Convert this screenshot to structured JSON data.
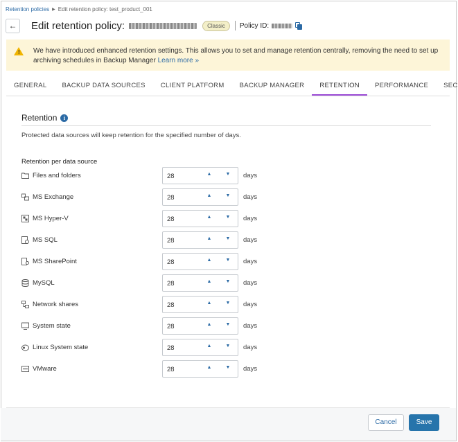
{
  "breadcrumb": {
    "parent": "Retention policies",
    "current": "Edit retention policy: test_product_001"
  },
  "header": {
    "title": "Edit retention policy:",
    "badge": "Classic",
    "policy_id_label": "Policy ID:"
  },
  "banner": {
    "text": "We have introduced enhanced retention settings. This allows you to set and manage retention centrally, removing the need to set up archiving schedules in Backup Manager",
    "link": "Learn more »"
  },
  "tabs": [
    {
      "label": "GENERAL"
    },
    {
      "label": "BACKUP DATA SOURCES"
    },
    {
      "label": "CLIENT PLATFORM"
    },
    {
      "label": "BACKUP MANAGER"
    },
    {
      "label": "RETENTION"
    },
    {
      "label": "PERFORMANCE"
    },
    {
      "label": "SECURITY"
    }
  ],
  "active_tab": "RETENTION",
  "section": {
    "title": "Retention",
    "description": "Protected data sources will keep retention for the specified number of days.",
    "subheading": "Retention per data source"
  },
  "rows": [
    {
      "label": "Files and folders",
      "value": "28",
      "unit": "days",
      "icon": "folder-icon"
    },
    {
      "label": "MS Exchange",
      "value": "28",
      "unit": "days",
      "icon": "exchange-icon"
    },
    {
      "label": "MS Hyper-V",
      "value": "28",
      "unit": "days",
      "icon": "hyperv-icon"
    },
    {
      "label": "MS SQL",
      "value": "28",
      "unit": "days",
      "icon": "sql-icon"
    },
    {
      "label": "MS SharePoint",
      "value": "28",
      "unit": "days",
      "icon": "sharepoint-icon"
    },
    {
      "label": "MySQL",
      "value": "28",
      "unit": "days",
      "icon": "database-icon"
    },
    {
      "label": "Network shares",
      "value": "28",
      "unit": "days",
      "icon": "network-icon"
    },
    {
      "label": "System state",
      "value": "28",
      "unit": "days",
      "icon": "monitor-icon"
    },
    {
      "label": "Linux System state",
      "value": "28",
      "unit": "days",
      "icon": "linux-icon"
    },
    {
      "label": "VMware",
      "value": "28",
      "unit": "days",
      "icon": "vmware-icon"
    }
  ],
  "footer": {
    "cancel": "Cancel",
    "save": "Save"
  },
  "colors": {
    "accent": "#2b6aa5",
    "active_tab": "#9b4bd6",
    "banner_bg": "#fdf5d8",
    "save_bg": "#2674ab"
  }
}
